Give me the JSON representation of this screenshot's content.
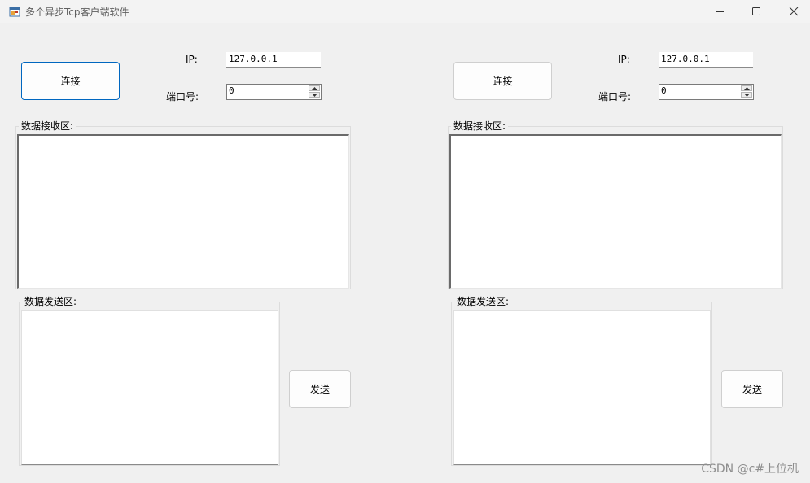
{
  "window": {
    "title": "多个异步Tcp客户端软件",
    "icon": "winforms-app-icon",
    "controls": [
      "minimize-icon",
      "maximize-icon",
      "close-icon"
    ]
  },
  "left_panel": {
    "connect_label": "连接",
    "ip_label": "IP:",
    "ip_value": "127.0.0.1",
    "port_label": "端口号:",
    "port_value": "0",
    "receive_group_title": "数据接收区:",
    "send_group_title": "数据发送区:",
    "send_label": "发送"
  },
  "right_panel": {
    "connect_label": "连接",
    "ip_label": "IP:",
    "ip_value": "127.0.0.1",
    "port_label": "端口号:",
    "port_value": "0",
    "receive_group_title": "数据接收区:",
    "send_group_title": "数据发送区:",
    "send_label": "发送"
  },
  "watermark": "CSDN @c#上位机",
  "colors": {
    "focus_border": "#0067c0",
    "background": "#f0f0f0"
  }
}
